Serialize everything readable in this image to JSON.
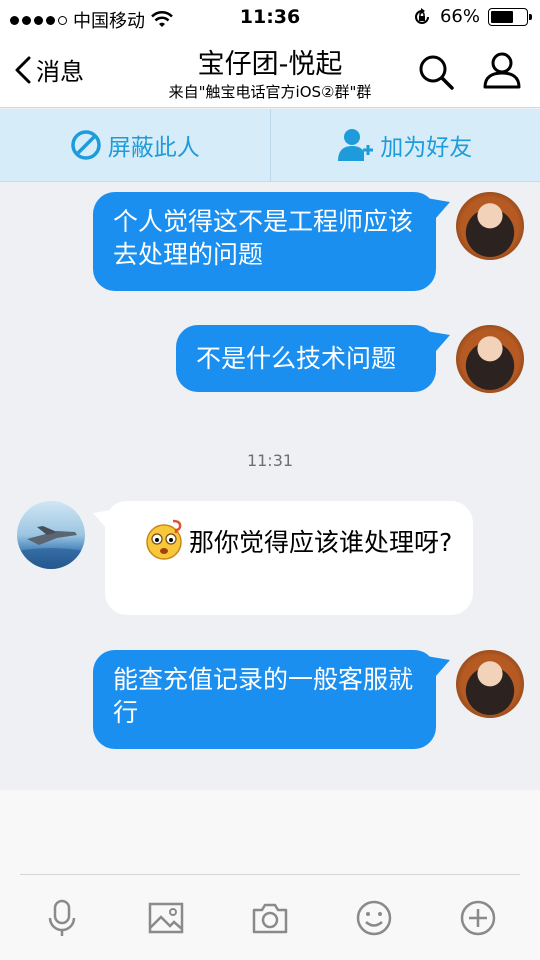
{
  "status_bar": {
    "carrier": "中国移动",
    "time": "11:36",
    "battery_percent": "66%",
    "battery_level": 0.66
  },
  "nav": {
    "back_label": "消息",
    "title": "宝仔团-悦起",
    "subtitle": "来自\"触宝电话官方iOS②群\"群"
  },
  "actions": {
    "block_label": "屏蔽此人",
    "add_friend_label": "加为好友"
  },
  "messages": [
    {
      "sender": "me",
      "text": "个人觉得这不是工程师应该去处理的问题"
    },
    {
      "sender": "me",
      "text": "不是什么技术问题"
    },
    {
      "sender": "them",
      "text": "那你觉得应该谁处理呀?"
    },
    {
      "sender": "me",
      "text": "能查充值记录的一般客服就行"
    }
  ],
  "timestamp": "11:31",
  "colors": {
    "accent": "#1a8ff0",
    "action_bar_bg": "#d6ecf9",
    "action_text": "#1e9bdb"
  },
  "toolbar_icons": [
    "microphone-icon",
    "image-icon",
    "camera-icon",
    "emoji-icon",
    "plus-icon"
  ]
}
